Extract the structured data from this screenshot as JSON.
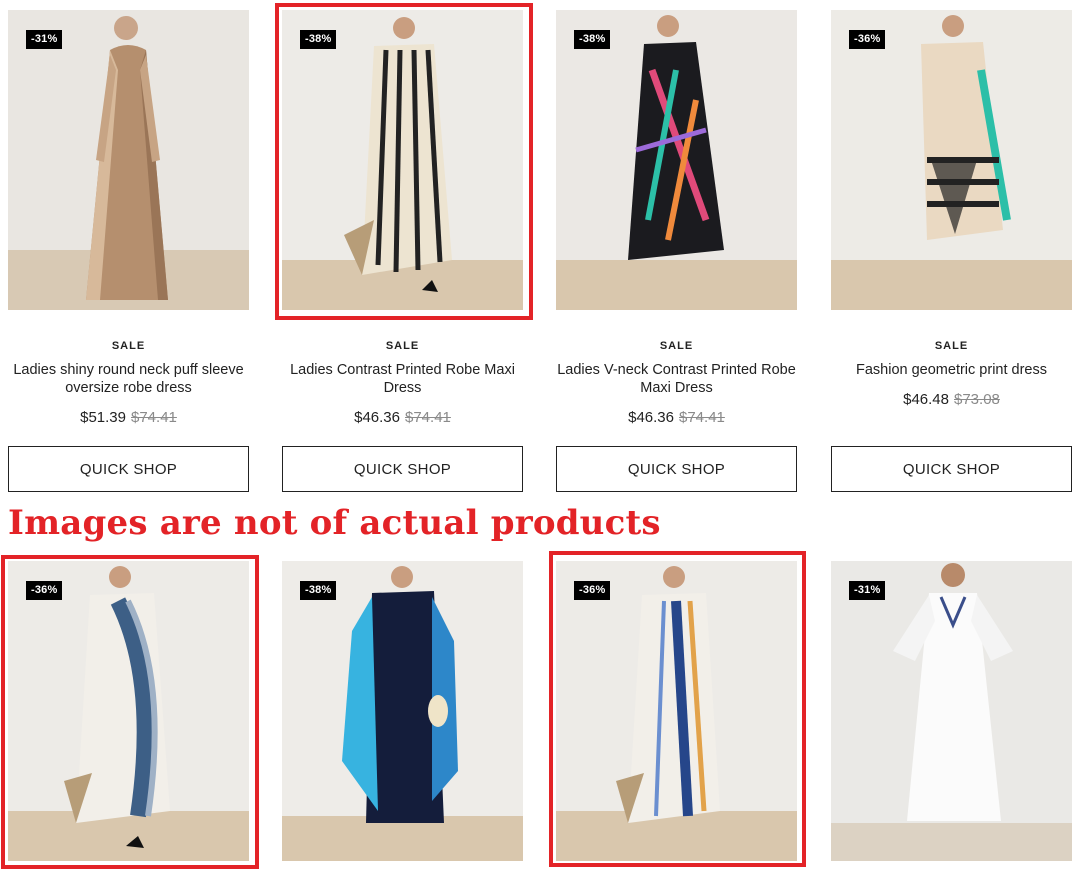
{
  "products": [
    {
      "discount": "-31%",
      "sale": "SALE",
      "name": "Ladies shiny round neck puff sleeve oversize robe dress",
      "price": "$51.39",
      "old_price": "$74.41",
      "button": "QUICK SHOP"
    },
    {
      "discount": "-38%",
      "sale": "SALE",
      "name": "Ladies Contrast Printed Robe Maxi Dress",
      "price": "$46.36",
      "old_price": "$74.41",
      "button": "QUICK SHOP"
    },
    {
      "discount": "-38%",
      "sale": "SALE",
      "name": "Ladies V-neck Contrast Printed Robe Maxi Dress",
      "price": "$46.36",
      "old_price": "$74.41",
      "button": "QUICK SHOP"
    },
    {
      "discount": "-36%",
      "sale": "SALE",
      "name": "Fashion geometric print dress",
      "price": "$46.48",
      "old_price": "$73.08",
      "button": "QUICK SHOP"
    }
  ],
  "second_row": [
    {
      "discount": "-36%"
    },
    {
      "discount": "-38%"
    },
    {
      "discount": "-36%"
    },
    {
      "discount": "-31%"
    }
  ],
  "annotation": {
    "text": "Images are not of actual products",
    "color": "#e32327"
  }
}
